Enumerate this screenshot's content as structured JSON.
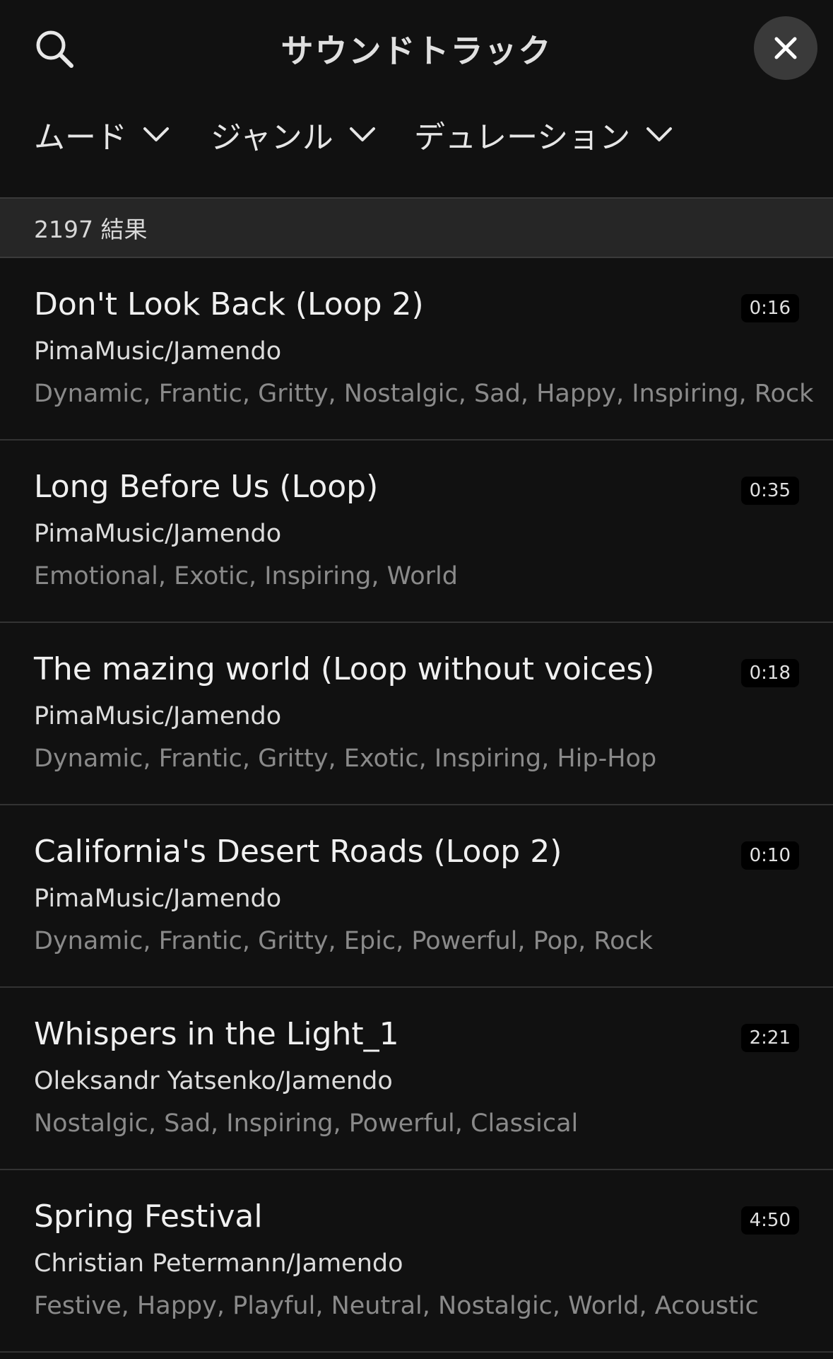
{
  "header": {
    "title": "サウンドトラック",
    "search_icon": "search-icon",
    "close_icon": "close-icon"
  },
  "filters": [
    {
      "label": "ムード"
    },
    {
      "label": "ジャンル"
    },
    {
      "label": "デュレーション"
    }
  ],
  "results": {
    "count_text": "2197 結果"
  },
  "tracks": [
    {
      "title": "Don't Look Back (Loop 2)",
      "artist": "PimaMusic/Jamendo",
      "tags": "Dynamic, Frantic, Gritty, Nostalgic, Sad, Happy, Inspiring, Rock",
      "duration": "0:16"
    },
    {
      "title": "Long Before Us (Loop)",
      "artist": "PimaMusic/Jamendo",
      "tags": "Emotional, Exotic, Inspiring, World",
      "duration": "0:35"
    },
    {
      "title": "The mazing world (Loop without voices)",
      "artist": "PimaMusic/Jamendo",
      "tags": "Dynamic, Frantic, Gritty, Exotic, Inspiring, Hip-Hop",
      "duration": "0:18"
    },
    {
      "title": "California's Desert Roads (Loop 2)",
      "artist": "PimaMusic/Jamendo",
      "tags": "Dynamic, Frantic, Gritty, Epic, Powerful, Pop, Rock",
      "duration": "0:10"
    },
    {
      "title": "Whispers in the Light_1",
      "artist": "Oleksandr Yatsenko/Jamendo",
      "tags": "Nostalgic, Sad, Inspiring, Powerful, Classical",
      "duration": "2:21"
    },
    {
      "title": "Spring Festival",
      "artist": "Christian Petermann/Jamendo",
      "tags": "Festive, Happy, Playful, Neutral, Nostalgic, World, Acoustic",
      "duration": "4:50"
    }
  ],
  "colors": {
    "background": "#111111",
    "results_bar": "#262626",
    "close_button": "#3a3a3a",
    "tag_text": "#8a8a8a"
  }
}
